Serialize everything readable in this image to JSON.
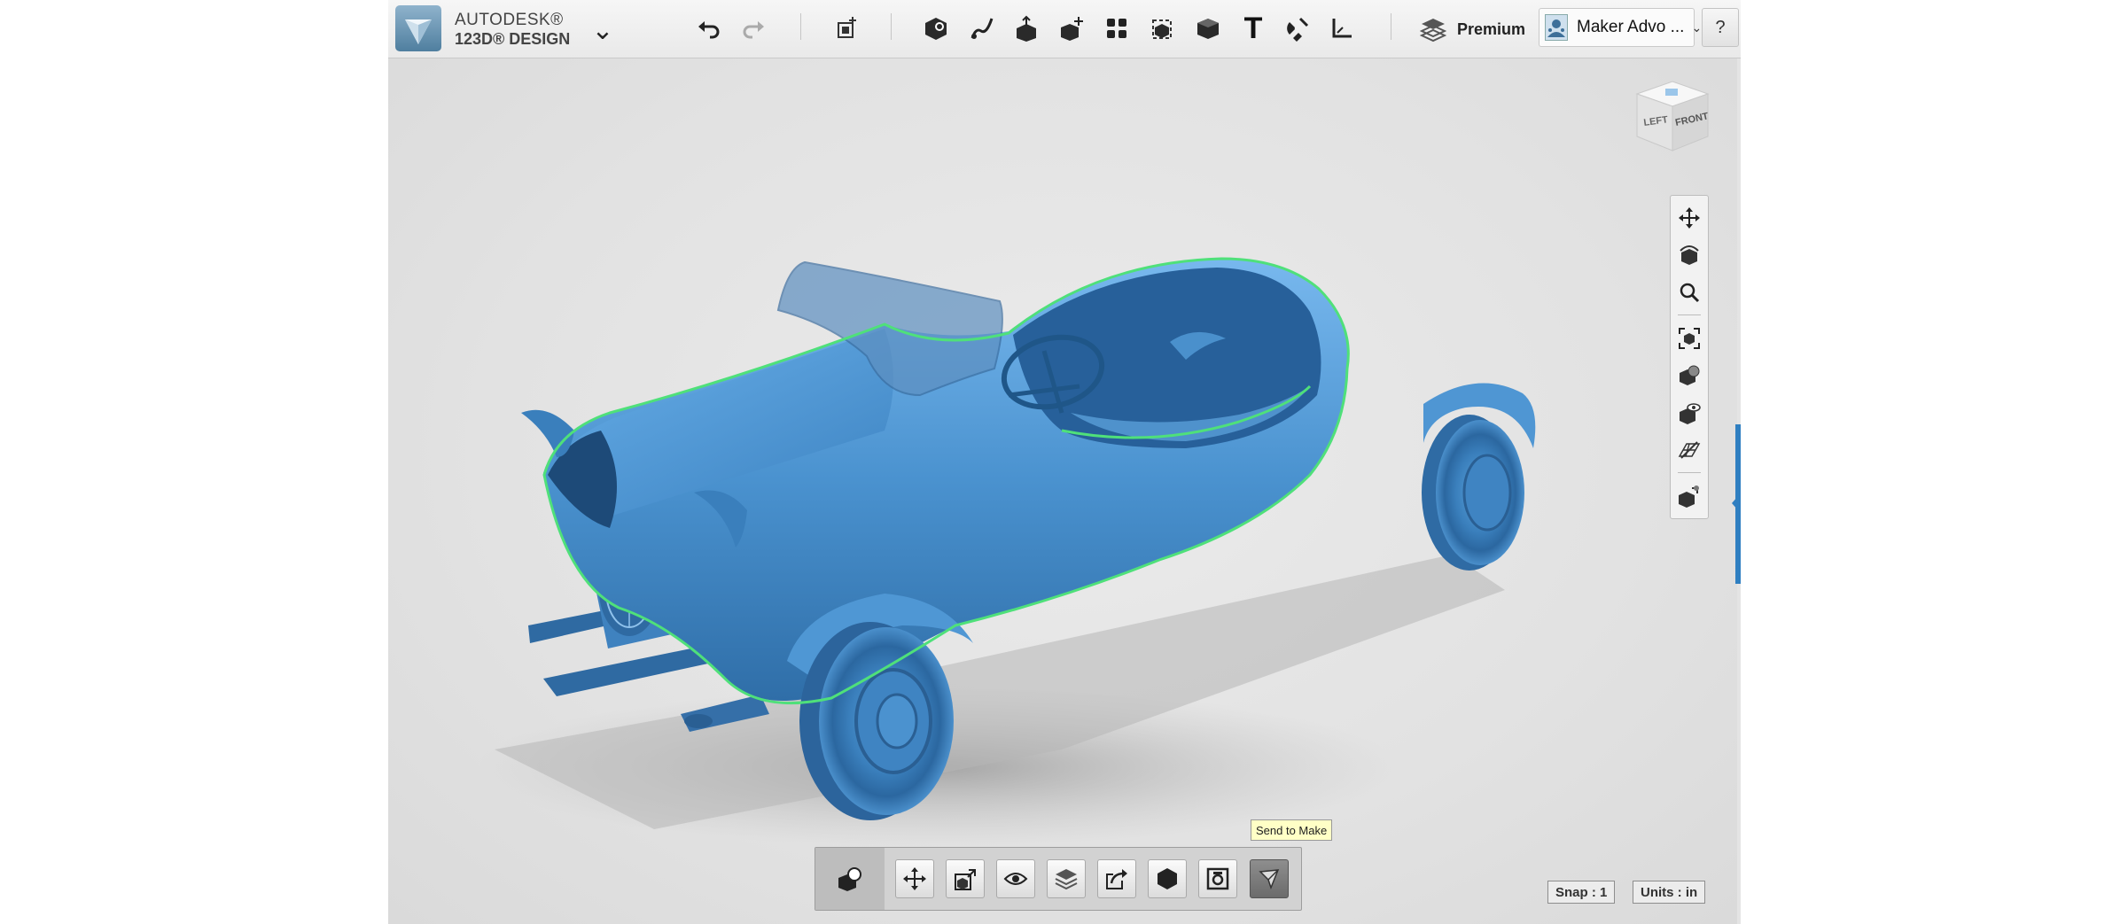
{
  "app": {
    "brand_line1": "AUTODESK®",
    "brand_line2": "123D® DESIGN",
    "menu_caret": "⌄"
  },
  "toolbar": {
    "premium_label": "Premium",
    "user_name": "Maker Advo ...",
    "user_caret": "⌄",
    "help_label": "?",
    "text_tool_glyph": "T"
  },
  "viewcube": {
    "left_label": "LEFT",
    "front_label": "FRONT"
  },
  "tooltip": {
    "text": "Send to Make"
  },
  "status": {
    "snap": "Snap : 1",
    "units": "Units : in"
  },
  "colors": {
    "model_blue": "#4a92cf",
    "selection_outline": "#4fe07a",
    "accent": "#2f7fc1",
    "toolbar_bg": "#eeeeee"
  },
  "icons": {
    "top": [
      "undo-icon",
      "redo-icon",
      "add-primitive-icon",
      "primitives-icon",
      "sketch-icon",
      "construct-icon",
      "modify-icon",
      "pattern-icon",
      "grouping-icon",
      "combine-icon",
      "text-icon",
      "snap-icon",
      "measure-icon",
      "premium-layers-icon"
    ],
    "nav": [
      "pan-icon",
      "orbit-icon",
      "zoom-icon",
      "fit-icon",
      "material-icon",
      "visibility-icon",
      "grid-icon",
      "solid-ops-icon"
    ],
    "bottom": [
      "solid-icon",
      "move-icon",
      "smart-scale-icon",
      "eye-icon",
      "layers-icon",
      "export-icon",
      "hexagon-icon",
      "snapshot-icon",
      "send-to-make-icon"
    ]
  }
}
